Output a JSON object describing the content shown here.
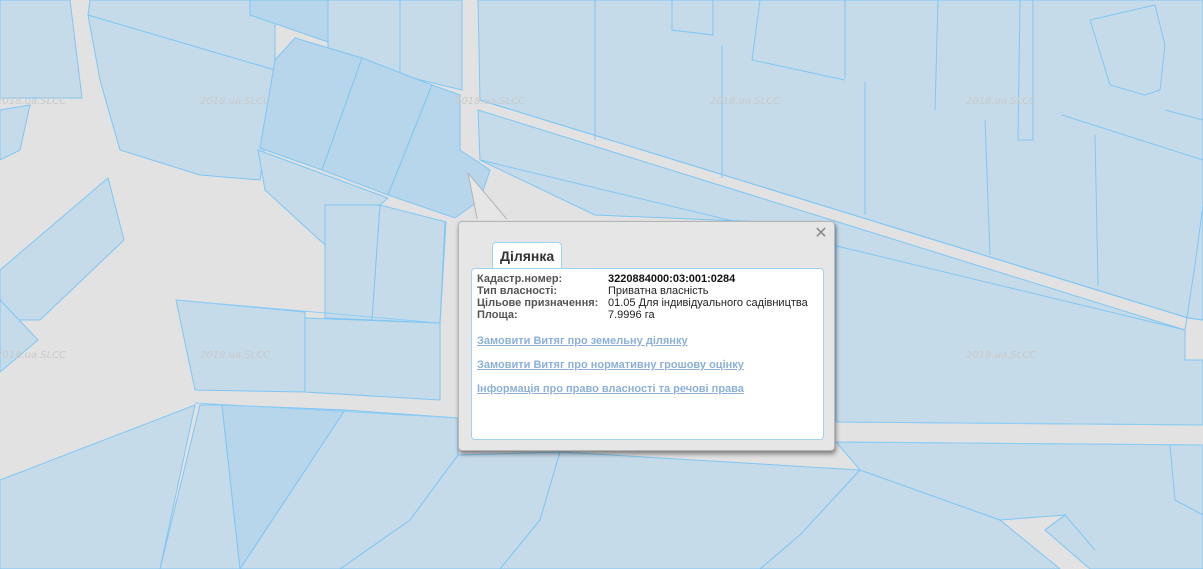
{
  "map": {
    "watermark": "2018.ua.SLCC",
    "colors": {
      "parcel": "#c5dbea",
      "parcel_selected": "#b7d6ec",
      "parcel_border": "#7fc6f3",
      "road": "#e2e2e2",
      "link": "#8db0d9"
    }
  },
  "popup": {
    "tab_label": "Ділянка",
    "close_icon": "close-icon",
    "fields": [
      {
        "label": "Кадастр.номер:",
        "value": "3220884000:03:001:0284"
      },
      {
        "label": "Тип власності:",
        "value": "Приватна власність"
      },
      {
        "label": "Цільове призначення:",
        "value": "01.05 Для індивідуального садівництва"
      },
      {
        "label": "Площа:",
        "value": "7.9996 га"
      }
    ],
    "links": [
      "Замовити Витяг про земельну ділянку",
      "Замовити Витяг про нормативну грошову оцінку",
      "Інформація про право власності та речові права"
    ]
  }
}
